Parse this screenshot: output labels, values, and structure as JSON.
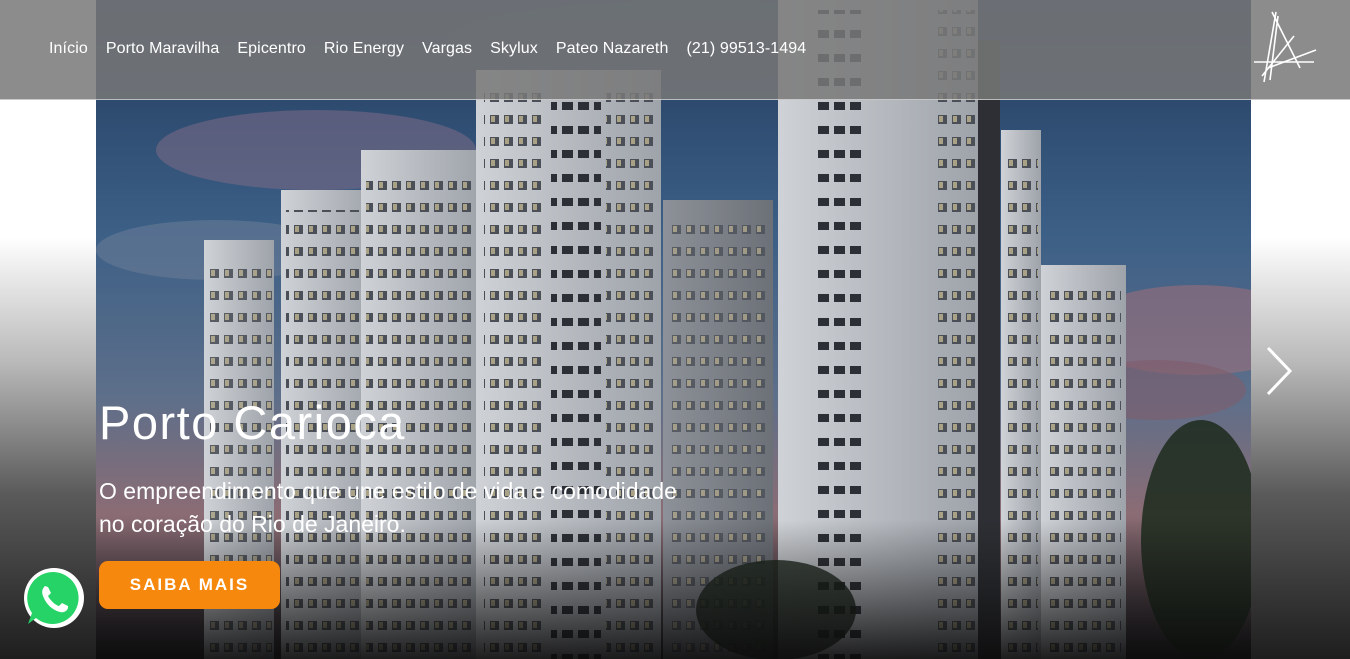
{
  "nav": {
    "items": [
      {
        "label": "Início"
      },
      {
        "label": "Porto Maravilha"
      },
      {
        "label": "Epicentro"
      },
      {
        "label": "Rio Energy"
      },
      {
        "label": "Vargas"
      },
      {
        "label": "Skylux"
      },
      {
        "label": "Pateo Nazareth"
      },
      {
        "label": "(21) 99513-1494"
      }
    ]
  },
  "hero": {
    "title": "Porto Carioca",
    "subtitle": "O empreendimento que une estilo de vida e comodidade no coração do Rio de Janeiro.",
    "cta_label": "SAIBA MAIS"
  },
  "icons": {
    "logo": "stylized-letter-a-logo",
    "next": "chevron-right-icon",
    "whatsapp": "whatsapp-icon"
  },
  "colors": {
    "accent": "#f7880e",
    "header_bg": "#787878",
    "whatsapp": "#25d366",
    "text": "#ffffff"
  }
}
